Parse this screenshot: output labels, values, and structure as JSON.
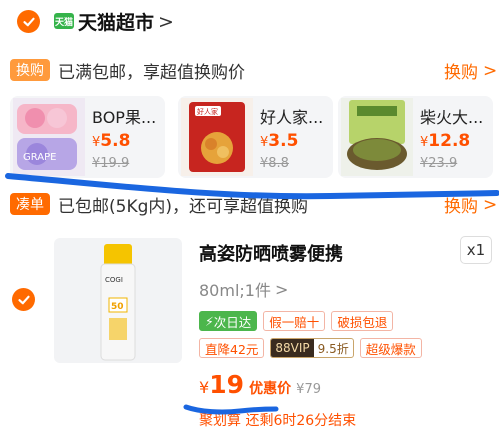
{
  "store": {
    "logo_text": "天猫",
    "name": "天猫超市",
    "chevron": ">"
  },
  "exchange": {
    "tag": "换购",
    "text": "已满包邮，享超值换购价",
    "link": "换购",
    "chevron": ">",
    "items": [
      {
        "name": "BOP果...",
        "currency": "¥",
        "price": "5.8",
        "original": "¥19.9"
      },
      {
        "name": "好人家...",
        "currency": "¥",
        "price": "3.5",
        "original": "¥8.8"
      },
      {
        "name": "柴火大...",
        "currency": "¥",
        "price": "12.8",
        "original": "¥23.9"
      }
    ]
  },
  "bundle": {
    "tag": "凑单",
    "text": "已包邮(5Kg内)，还可享超值换购",
    "link": "换购",
    "chevron": ">"
  },
  "product": {
    "title": "高姿防晒喷雾便携",
    "quantity": "x1",
    "spec": "80ml;1件",
    "spec_chevron": ">",
    "badges_row1": [
      "次日达",
      "假一赔十",
      "破损包退"
    ],
    "badges_row2": [
      "直降42元",
      "超级爆款"
    ],
    "vip": {
      "left": "88VIP",
      "right": "9.5折"
    },
    "price_currency": "¥",
    "price": "19",
    "price_label": "优惠价",
    "original_price": "¥79",
    "countdown": "聚划算 还剩6时26分结束"
  },
  "colors": {
    "accent": "#ff6a00",
    "price": "#ff5000",
    "annotation_stroke": "#1a66e0"
  }
}
